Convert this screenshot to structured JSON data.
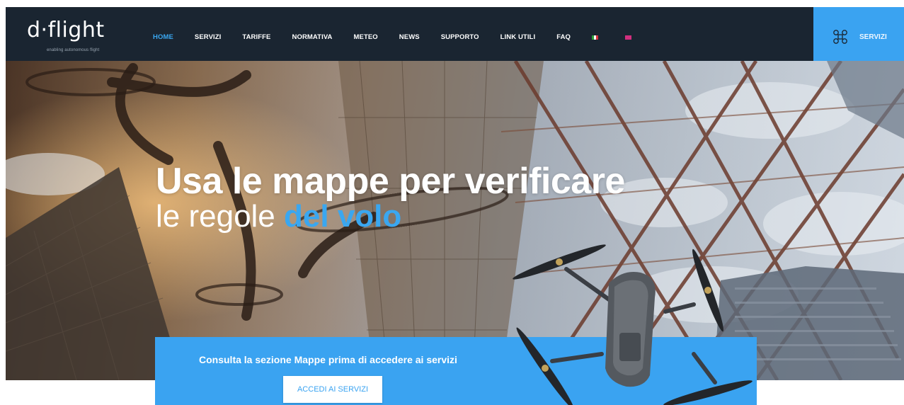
{
  "header": {
    "logo_text": "d·flight",
    "logo_tagline": "enabling autonomous flight",
    "nav": [
      "HOME",
      "SERVIZI",
      "TARIFFE",
      "NORMATIVA",
      "METEO",
      "NEWS",
      "SUPPORTO",
      "LINK UTILI",
      "FAQ"
    ],
    "active_nav": "HOME",
    "languages": [
      "it",
      "en"
    ],
    "cta_label": "SERVIZI",
    "cta_icon": "drone-icon"
  },
  "hero": {
    "title": "Usa le mappe per verificare",
    "subtitle_plain": "le regole ",
    "subtitle_highlight": "del volo"
  },
  "cta_panel": {
    "text": "Consulta la sezione Mappe prima di accedere ai servizi",
    "button_label": "ACCEDI AI SERVIZI"
  },
  "colors": {
    "navbar": "#1a2531",
    "accent": "#3aa3f1",
    "active_nav": "#3aa7f0",
    "logo_dot": "#d8323c"
  }
}
